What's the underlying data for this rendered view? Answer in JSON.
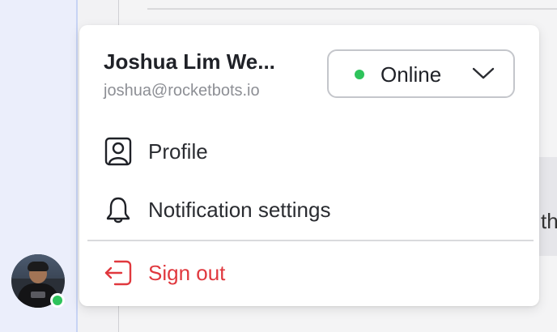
{
  "background": {
    "peek_text": "th"
  },
  "user": {
    "name": "Joshua Lim We...",
    "email": "joshua@rocketbots.io",
    "presence_color": "#2ec35b"
  },
  "status_select": {
    "selected": "Online",
    "dot_color": "#2ec35b",
    "icon": "chevron-down-icon"
  },
  "menu": {
    "items": [
      {
        "label": "Profile",
        "icon": "user-profile-icon"
      },
      {
        "label": "Notification settings",
        "icon": "bell-icon"
      }
    ],
    "sign_out": {
      "label": "Sign out",
      "icon": "sign-out-icon",
      "color": "#e0383e"
    }
  }
}
